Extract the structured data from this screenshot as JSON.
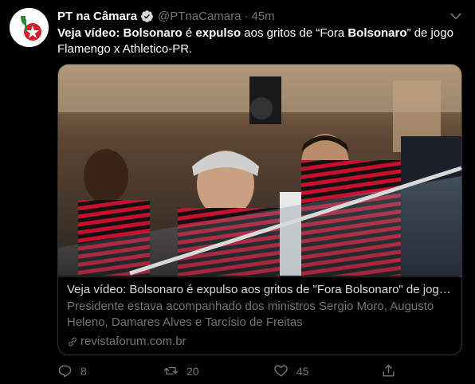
{
  "tweet": {
    "display_name": "PT na Câmara",
    "handle": "@PTnaCamara",
    "separator": "·",
    "time": "45m",
    "text_parts": [
      {
        "t": "Veja vídeo: ",
        "b": true
      },
      {
        "t": "Bolsonaro",
        "b": true
      },
      {
        "t": " é ",
        "b": false
      },
      {
        "t": "expulso",
        "b": true
      },
      {
        "t": " aos gritos de “Fora ",
        "b": false
      },
      {
        "t": "Bolsonaro",
        "b": true
      },
      {
        "t": "” de jogo Flamengo x Athletico-PR.",
        "b": false
      }
    ]
  },
  "card": {
    "title": "Veja vídeo: Bolsonaro é expulso aos gritos de \"Fora Bolsonaro\" de jogo ...",
    "description": "Presidente estava acompanhado dos ministros Sergio Moro, Augusto Heleno, Damares Alves e Tarcísio de Freitas",
    "domain": "revistaforum.com.br"
  },
  "actions": {
    "replies": "8",
    "retweets": "20",
    "likes": "45"
  },
  "colors": {
    "background": "#000000",
    "text": "#ffffff",
    "secondary": "#6e767d",
    "border": "#2f3336",
    "verified": "#d9d9d9",
    "flamengo_red": "#c8102e"
  }
}
